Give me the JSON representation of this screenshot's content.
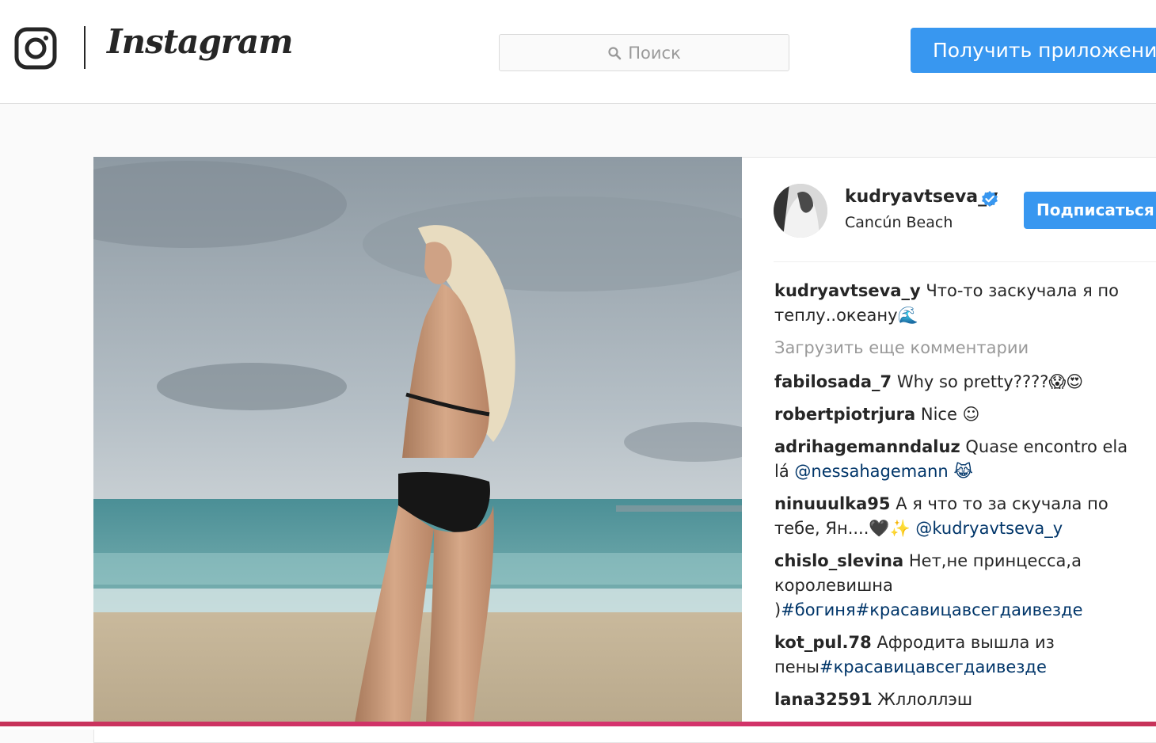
{
  "header": {
    "brand": "Instagram",
    "search_placeholder": "Поиск",
    "get_app_label": "Получить приложение"
  },
  "post": {
    "author": "kudryavtseva_y",
    "verified": true,
    "location": "Cancún Beach",
    "follow_label": "Подписаться",
    "caption": {
      "user": "kudryavtseva_y",
      "text": "Что-то заскучала я по теплу..океану🌊"
    },
    "load_more_label": "Загрузить еще комментарии",
    "comments": [
      {
        "user": "fabilosada_7",
        "text": "Why so pretty????😱😍",
        "tag": ""
      },
      {
        "user": "robertpiotrjura",
        "text": "Nice ☺",
        "tag": ""
      },
      {
        "user": "adrihagemanndaluz",
        "text": "Quase encontro ela lá",
        "tag": "@nessahagemann 😹"
      },
      {
        "user": "ninuuulka95",
        "text": "А я что то за скучала по тебе, Ян....🖤✨",
        "tag": "@kudryavtseva_y"
      },
      {
        "user": "chislo_slevina",
        "text": "Нет,не принцесса,а королевишна )",
        "tag": "#богиня#красавицавсегдаивезде"
      },
      {
        "user": "kot_pul.78",
        "text": "Афродита вышла из пены",
        "tag": "#красавицавсегдаивезде"
      },
      {
        "user": "lana32591",
        "text": "Жллоллэш",
        "tag": ""
      }
    ]
  },
  "colors": {
    "accent": "#3897f0",
    "text": "#262626",
    "muted": "#999999",
    "link": "#003569",
    "bottom_bar": "#d6336f"
  },
  "icons": {
    "logo": "instagram-glyph-icon",
    "search": "search-icon",
    "verified": "verified-badge-icon"
  }
}
